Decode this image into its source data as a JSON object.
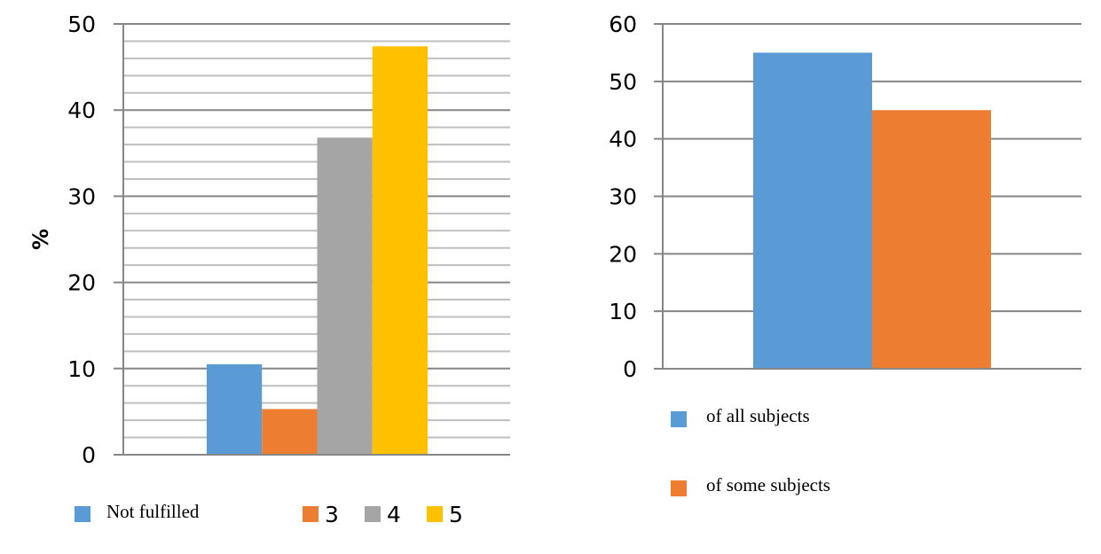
{
  "chart_data": [
    {
      "type": "bar",
      "title": "",
      "xlabel": "",
      "ylabel": "%",
      "ylim": [
        0,
        50
      ],
      "major_ticks": [
        0,
        10,
        20,
        30,
        40,
        50
      ],
      "tick_labels": [
        "0",
        "10",
        "20",
        "30",
        "40",
        "50"
      ],
      "minor_step": 2,
      "grid": true,
      "categories": [
        ""
      ],
      "series": [
        {
          "name": "Not fulfilled",
          "values": [
            10.5
          ],
          "color": "#5B9BD5"
        },
        {
          "name": "3",
          "values": [
            5.3
          ],
          "color": "#ED7D31"
        },
        {
          "name": "4",
          "values": [
            36.8
          ],
          "color": "#A5A5A5"
        },
        {
          "name": "5",
          "values": [
            47.4
          ],
          "color": "#FFC000"
        }
      ],
      "legend": {
        "placement": "bottom",
        "entries": [
          "Not fulfilled",
          "3",
          "4",
          "5"
        ]
      }
    },
    {
      "type": "bar",
      "title": "",
      "xlabel": "",
      "ylabel": "",
      "ylim": [
        0,
        60
      ],
      "major_ticks": [
        0,
        10,
        20,
        30,
        40,
        50,
        60
      ],
      "tick_labels": [
        "0",
        "10",
        "20",
        "30",
        "40",
        "50",
        "60"
      ],
      "grid": true,
      "categories": [
        ""
      ],
      "series": [
        {
          "name": "of all subjects",
          "values": [
            55
          ],
          "color": "#5B9BD5"
        },
        {
          "name": "of some subjects",
          "values": [
            45
          ],
          "color": "#ED7D31"
        }
      ],
      "legend": {
        "placement": "bottom-left",
        "entries": [
          "of all subjects",
          "of some subjects"
        ]
      }
    }
  ]
}
